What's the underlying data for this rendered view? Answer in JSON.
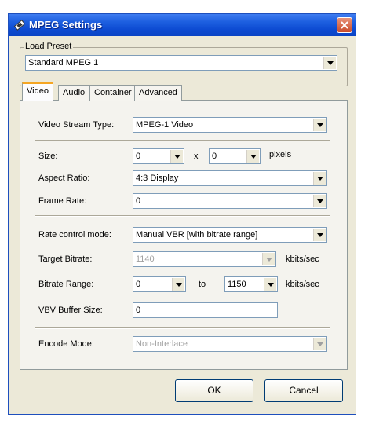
{
  "window": {
    "title": "MPEG Settings"
  },
  "preset": {
    "label": "Load Preset",
    "value": "Standard MPEG 1"
  },
  "tabs": [
    {
      "label": "Video"
    },
    {
      "label": "Audio"
    },
    {
      "label": "Container"
    },
    {
      "label": "Advanced"
    }
  ],
  "video": {
    "stream_type_label": "Video Stream Type:",
    "stream_type_value": "MPEG-1 Video",
    "size_label": "Size:",
    "size_width": "0",
    "size_x": "x",
    "size_height": "0",
    "size_unit": "pixels",
    "aspect_label": "Aspect Ratio:",
    "aspect_value": "4:3 Display",
    "framerate_label": "Frame Rate:",
    "framerate_value": "0",
    "rate_mode_label": "Rate control mode:",
    "rate_mode_value": "Manual VBR [with bitrate range]",
    "target_bitrate_label": "Target Bitrate:",
    "target_bitrate_value": "1140",
    "target_bitrate_unit": "kbits/sec",
    "bitrate_range_label": "Bitrate Range:",
    "bitrate_min": "0",
    "bitrate_to": "to",
    "bitrate_max": "1150",
    "bitrate_range_unit": "kbits/sec",
    "vbv_label": "VBV Buffer Size:",
    "vbv_value": "0",
    "encode_mode_label": "Encode Mode:",
    "encode_mode_value": "Non-Interlace"
  },
  "buttons": {
    "ok": "OK",
    "cancel": "Cancel"
  },
  "colors": {
    "titlebar": "#0a44c4",
    "dialog_bg": "#ece9d8",
    "close": "#c94b2a",
    "tab_highlight": "#f5a623"
  }
}
